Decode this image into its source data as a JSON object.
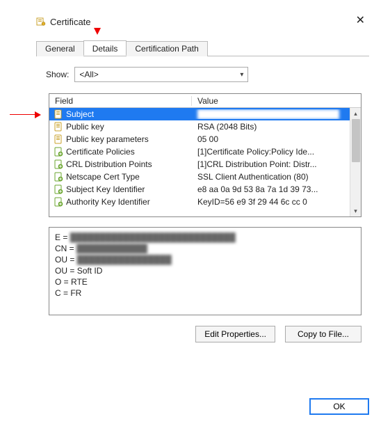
{
  "title": "Certificate",
  "tabs": {
    "general": "General",
    "details": "Details",
    "certpath": "Certification Path"
  },
  "active_tab": "details",
  "show": {
    "label": "Show:",
    "selected": "<All>"
  },
  "list": {
    "headers": {
      "field": "Field",
      "value": "Value"
    },
    "rows": [
      {
        "field": "Subject",
        "value": "████████████████████████",
        "selected": true,
        "icon": "doc",
        "value_blurred": true
      },
      {
        "field": "Public key",
        "value": "RSA (2048 Bits)",
        "selected": false,
        "icon": "doc"
      },
      {
        "field": "Public key parameters",
        "value": "05 00",
        "selected": false,
        "icon": "doc"
      },
      {
        "field": "Certificate Policies",
        "value": "[1]Certificate Policy:Policy Ide...",
        "selected": false,
        "icon": "ext"
      },
      {
        "field": "CRL Distribution Points",
        "value": "[1]CRL Distribution Point: Distr...",
        "selected": false,
        "icon": "ext"
      },
      {
        "field": "Netscape Cert Type",
        "value": "SSL Client Authentication (80)",
        "selected": false,
        "icon": "ext"
      },
      {
        "field": "Subject Key Identifier",
        "value": "e8 aa 0a 9d 53 8a 7a 1d 39 73...",
        "selected": false,
        "icon": "ext"
      },
      {
        "field": "Authority Key Identifier",
        "value": "KeyID=56 e9 3f 29 44 6c cc 0",
        "selected": false,
        "icon": "ext"
      }
    ]
  },
  "detail_lines": [
    {
      "k": "E",
      "v": "████████████████████████████",
      "blur": true
    },
    {
      "k": "CN",
      "v": "████████████",
      "blur": true
    },
    {
      "k": "OU",
      "v": "████████████████",
      "blur": true
    },
    {
      "k": "OU",
      "v": "Soft ID",
      "blur": false
    },
    {
      "k": "O",
      "v": "RTE",
      "blur": false
    },
    {
      "k": "C",
      "v": "FR",
      "blur": false
    }
  ],
  "buttons": {
    "edit_properties": "Edit Properties...",
    "copy_to_file": "Copy to File...",
    "ok": "OK"
  }
}
